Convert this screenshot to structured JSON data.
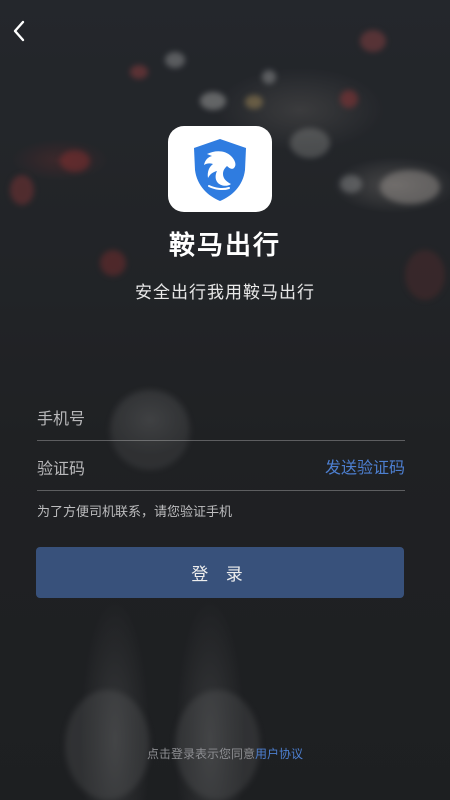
{
  "app": {
    "title": "鞍马出行",
    "slogan": "安全出行我用鞍马出行",
    "logo_icon": "horse-shield-icon",
    "brand_color": "#2f7ce0"
  },
  "nav": {
    "back_icon": "chevron-left-icon"
  },
  "form": {
    "phone_placeholder": "手机号",
    "phone_value": "",
    "code_placeholder": "验证码",
    "code_value": "",
    "send_code_label": "发送验证码",
    "hint": "为了方便司机联系，请您验证手机",
    "login_label": "登 录",
    "login_color": "#3b5683",
    "link_color": "#4d7fd0"
  },
  "footer": {
    "agreement_prefix": "点击登录表示您同意",
    "agreement_link": "用户协议"
  }
}
